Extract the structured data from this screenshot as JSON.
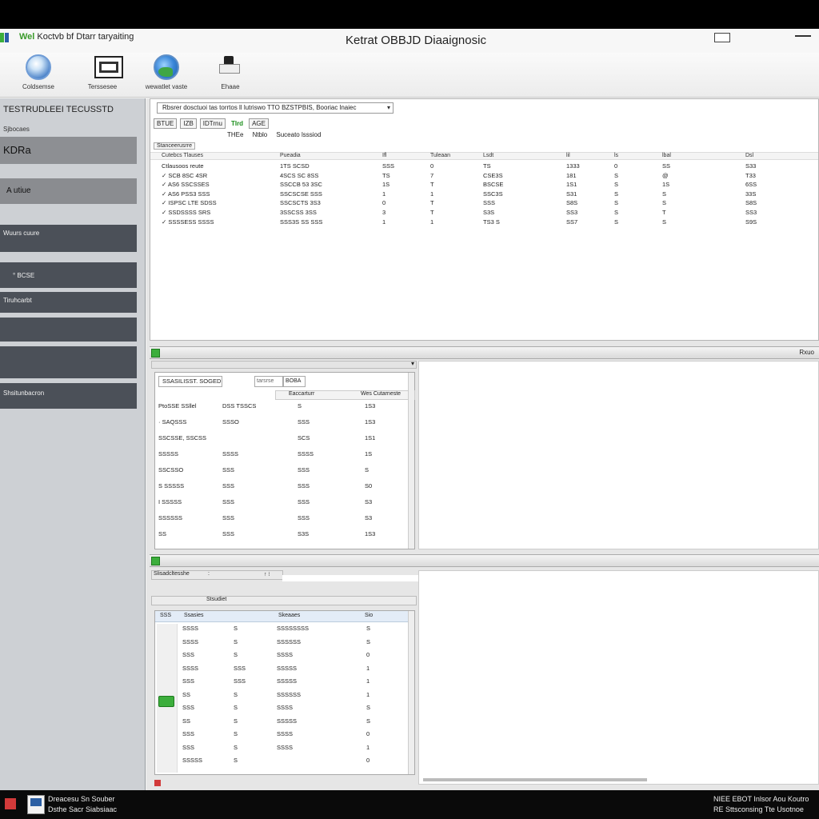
{
  "titlebar": {
    "app_tag": "Wel",
    "app_name": "Koctvb bf Dtarr taryaiting",
    "window_title": "Ketrat OBBJD Diaaignosic"
  },
  "toolbar": [
    {
      "label": "Coldsemse",
      "icon": "globe-icon"
    },
    {
      "label": "Terssesee",
      "icon": "monitor-icon"
    },
    {
      "label": "wewatlet vaste",
      "icon": "earth-icon"
    },
    {
      "label": "Ehaae",
      "icon": "tool-icon"
    }
  ],
  "left": {
    "header": "TESTRUDLEEI TECUSSTD",
    "sub": "Sjbocaes",
    "items": [
      {
        "label": "KDRa",
        "style": "light"
      },
      {
        "label": "A utiue",
        "style": "light2"
      },
      {
        "label": "Wuurs cuure",
        "style": "dark"
      },
      {
        "label": "° BCSE",
        "style": "dark"
      },
      {
        "label": "Tiruhcarbt",
        "style": "dark"
      },
      {
        "label": "",
        "style": "dark"
      },
      {
        "label": "",
        "style": "dark"
      },
      {
        "label": "Shsitunbacron",
        "style": "dark"
      }
    ]
  },
  "main": {
    "selector": "Rbsrer dosctuoi tas torrtos ll lutriswo TTO BZSTPBIS, Booriac lnaiec",
    "filters": [
      "BTUE",
      "IZB",
      "IDTrnu",
      "TIrd",
      "AGE"
    ],
    "pid_header": [
      "THEe",
      "Ntblo",
      "Suceato lsssiod"
    ],
    "tab_label": "Stanceerusrre",
    "grid1": {
      "headers": [
        "Cutebcs Tlauses",
        "Pueadia",
        "Ifl",
        "Tuleaan",
        "Lsdt",
        "lil",
        "ls",
        "lbal",
        "Dsl"
      ],
      "rows": [
        [
          "Ctlausoos reute",
          "1TS SCSD",
          "SSS",
          "0",
          "TS",
          "1333",
          "0",
          "SS",
          "S33"
        ],
        [
          "✓ SCB 8SC 4SR",
          "4SCS SC 8SS",
          "TS",
          "7",
          "CSE3S",
          "181",
          "S",
          "@",
          "T33"
        ],
        [
          "✓ AS6 SSCSSES",
          "SSCCB 53 3SC",
          "1S",
          "T",
          "BSCSE",
          "1S1",
          "S",
          "1S",
          "6SS"
        ],
        [
          "✓ AS6 PSS3 SSS",
          "SSCSCSE SSS",
          "1",
          "1",
          "SSC3S",
          "S31",
          "S",
          "S",
          "33S"
        ],
        [
          "✓ ISPSC LTE SDSS",
          "SSCSCTS 3S3",
          "0",
          "T",
          "SSS",
          "S8S",
          "S",
          "S",
          "S8S"
        ],
        [
          "✓ SSDSSSS SRS",
          "3SSCSS 3SS",
          "3",
          "T",
          "S3S",
          "SS3",
          "S",
          "T",
          "SS3"
        ],
        [
          "✓ SSSSESS SSSS",
          "SSS3S SS SSS",
          "1",
          "1",
          "TS3 S",
          "SS7",
          "S",
          "S",
          "S9S"
        ]
      ]
    },
    "section2_right": "Rxuo",
    "grid2": {
      "title": "SSASILISST. SOGED",
      "search": "tarsrse",
      "search_btn": "BOBA",
      "headers": [
        "Eaccarturr",
        "Wes Cutarneste"
      ],
      "rows": [
        [
          "PtoSSE SSllel",
          "DSS TSSCS",
          "S",
          "1S3"
        ],
        [
          "· SAQSSS",
          "SSSO",
          "SSS",
          "1S3"
        ],
        [
          "SSCSSE, SSCSS",
          "",
          "SCS",
          "1S1"
        ],
        [
          "SSSSS",
          "SSSS",
          "SSSS",
          "1S"
        ],
        [
          "SSCSSO",
          "SSS",
          "SSS",
          "S"
        ],
        [
          "S SSSSS",
          "SSS",
          "SSS",
          "S0"
        ],
        [
          "I SSSSS",
          "SSS",
          "SSS",
          "S3"
        ],
        [
          "SSSSSS",
          "SSS",
          "SSS",
          "S3"
        ],
        [
          "SS",
          "SSS",
          "S3S",
          "1S3"
        ]
      ]
    },
    "grid3": {
      "title": "Slisadcltesshe",
      "tab": "Stsudiet",
      "headers": [
        "SSS",
        "Ssasies",
        "Skeaaes",
        "Sio"
      ],
      "rows": [
        [
          "SSSS",
          "S",
          "SSSSSSSS",
          "S"
        ],
        [
          "SSSS",
          "S",
          "SSSSSS",
          "S"
        ],
        [
          "SSS",
          "S",
          "SSSS",
          "0"
        ],
        [
          "SSSS",
          "SSS",
          "SSSSS",
          "1"
        ],
        [
          "SSS",
          "SSS",
          "SSSSS",
          "1"
        ],
        [
          "SS",
          "S",
          "SSSSSS",
          "1"
        ],
        [
          "SSS",
          "S",
          "SSSS",
          "S"
        ],
        [
          "SS",
          "S",
          "SSSSS",
          "S"
        ],
        [
          "SSS",
          "S",
          "SSSS",
          "0"
        ],
        [
          "SSS",
          "S",
          "SSSS",
          "1"
        ],
        [
          "SSSSS",
          "S",
          "",
          "0"
        ]
      ]
    }
  },
  "taskbar": {
    "left_line1": "Dreacesu Sn Souber",
    "left_line2": "Dsthe Sacr Siabsiaac",
    "right_line1": "NIEE EBOT Inlsor Aou Koutro",
    "right_line2": "RE Sttsconsing Tte Usotnoe"
  },
  "colors": {
    "left_panel": "#cdd0d4",
    "dark_item": "#4b5058",
    "accent_green": "#3cae3c"
  }
}
